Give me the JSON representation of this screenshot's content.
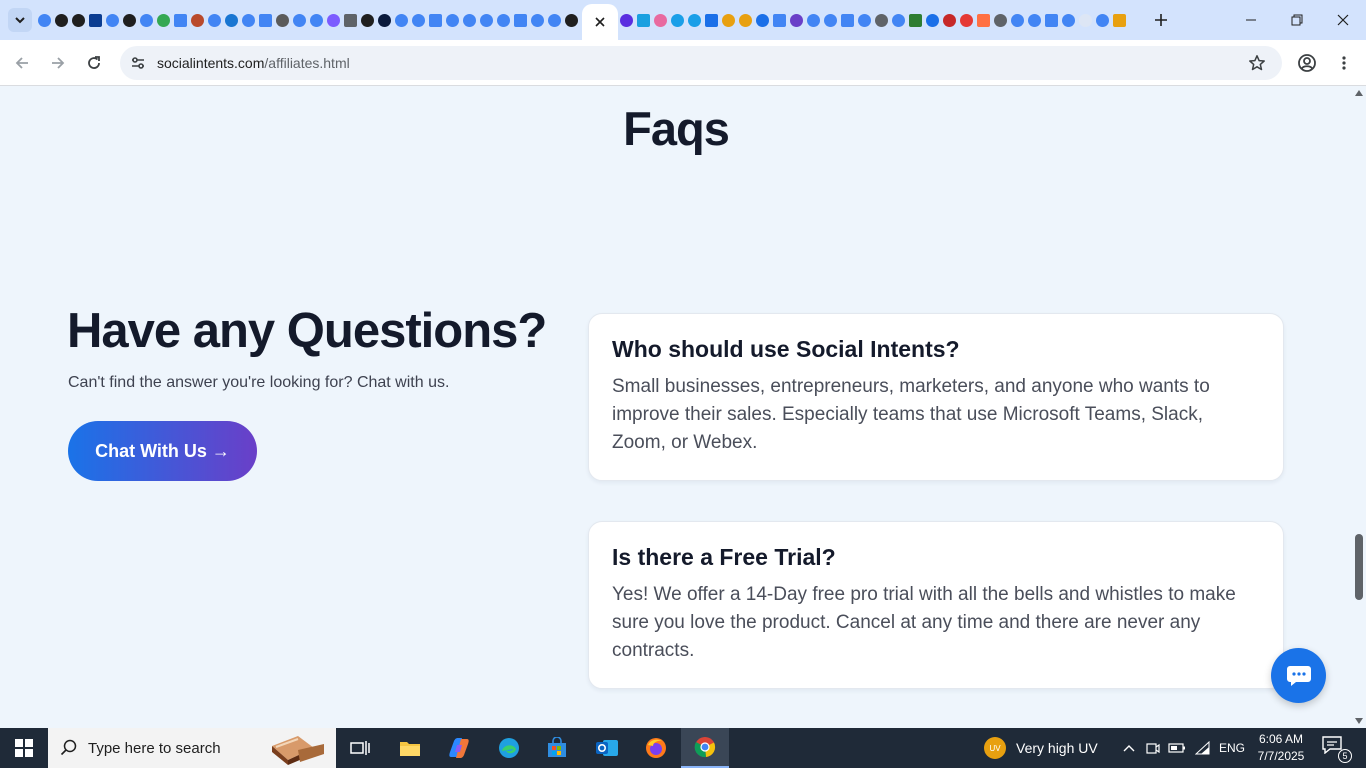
{
  "browser": {
    "url_host": "socialintents.com",
    "url_path": "/affiliates.html"
  },
  "page": {
    "faq_heading": "Faqs",
    "questions_title": "Have any Questions?",
    "questions_subtitle": "Can't find the answer you're looking for? Chat with us.",
    "chat_button_label": "Chat With Us →",
    "faqs": [
      {
        "question": "Who should use Social Intents?",
        "answer": "Small businesses, entrepreneurs, marketers, and anyone who wants to improve their sales. Especially teams that use Microsoft Teams, Slack, Zoom, or Webex."
      },
      {
        "question": "Is there a Free Trial?",
        "answer": "Yes! We offer a 14-Day free pro trial with all the bells and whistles to make sure you love the product. Cancel at any time and there are never any contracts."
      }
    ]
  },
  "taskbar": {
    "search_placeholder": "Type here to search",
    "weather_badge": "UV",
    "weather_text": "Very high UV",
    "language": "ENG",
    "time": "6:06 AM",
    "date": "7/7/2025",
    "notification_count": "5"
  },
  "colors": {
    "accent": "#1a73e8",
    "button_gradient_end": "#6a3fc8",
    "heading": "#141a2b",
    "page_bg": "#eef5fc"
  }
}
